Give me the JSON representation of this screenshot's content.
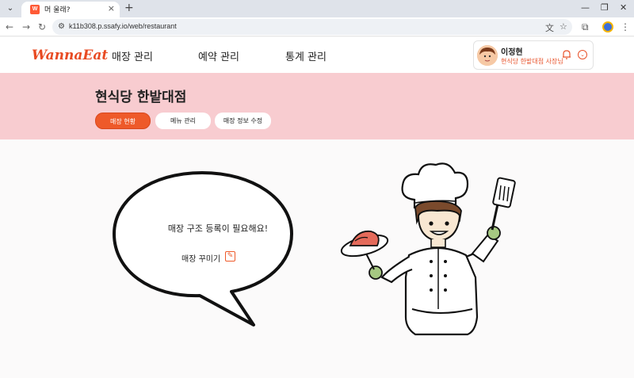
{
  "browser": {
    "tab_title": "머 울래?",
    "tab_favicon": "W",
    "url": "k11b308.p.ssafy.io/web/restaurant"
  },
  "header": {
    "logo": "WannaEat",
    "nav": [
      "매장 관리",
      "예약 관리",
      "통계 관리"
    ],
    "user_name": "이정현",
    "user_role": "현식당 한밭대점 사장님"
  },
  "banner": {
    "store_name": "현식당 한밭대점",
    "tabs": [
      "매장 현황",
      "메뉴 관리",
      "매장 정보 수정"
    ],
    "active_tab": "매장 현황"
  },
  "main": {
    "message": "매장 구조 등록이 필요해요!",
    "decorate_label": "매장 꾸미기"
  },
  "colors": {
    "accent": "#ee5a2a",
    "banner_bg": "#f8ccd0"
  },
  "icons": [
    "chevron-down-icon",
    "close-icon",
    "plus-icon",
    "back-arrow-icon",
    "forward-arrow-icon",
    "reload-icon",
    "site-settings-icon",
    "translate-icon",
    "star-icon",
    "extensions-icon",
    "bell-icon",
    "edit-icon"
  ]
}
